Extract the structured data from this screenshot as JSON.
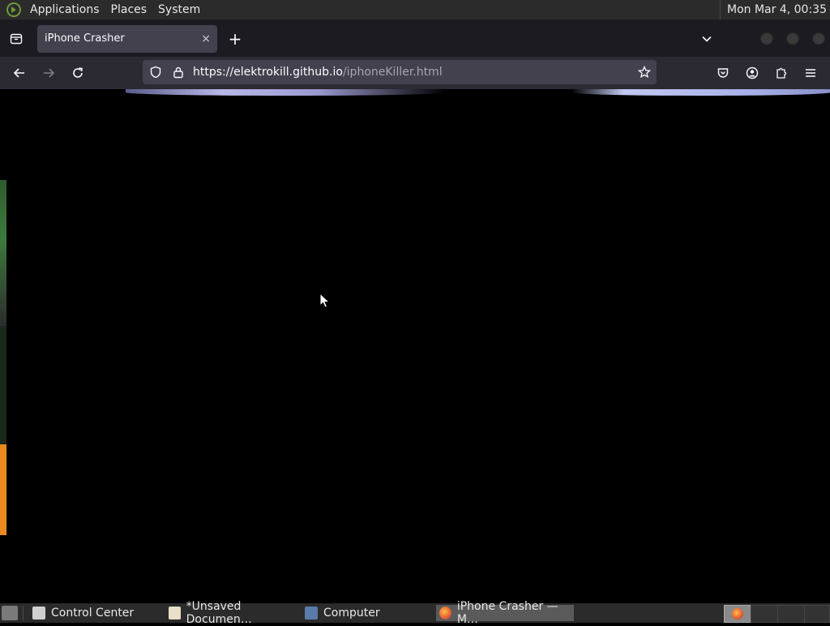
{
  "top_panel": {
    "menus": [
      "Applications",
      "Places",
      "System"
    ],
    "clock": "Mon Mar  4, 00:35"
  },
  "browser": {
    "tab_title": "iPhone Crasher",
    "close_tab": "×",
    "new_tab": "+",
    "url_host": "https://elektrokill.github.io",
    "url_path": "/iphoneKiller.html"
  },
  "taskbar": {
    "items": [
      {
        "label": "Control Center"
      },
      {
        "label": "*Unsaved Documen…"
      },
      {
        "label": "Computer"
      },
      {
        "label": "iPhone Crasher — M…"
      }
    ]
  }
}
